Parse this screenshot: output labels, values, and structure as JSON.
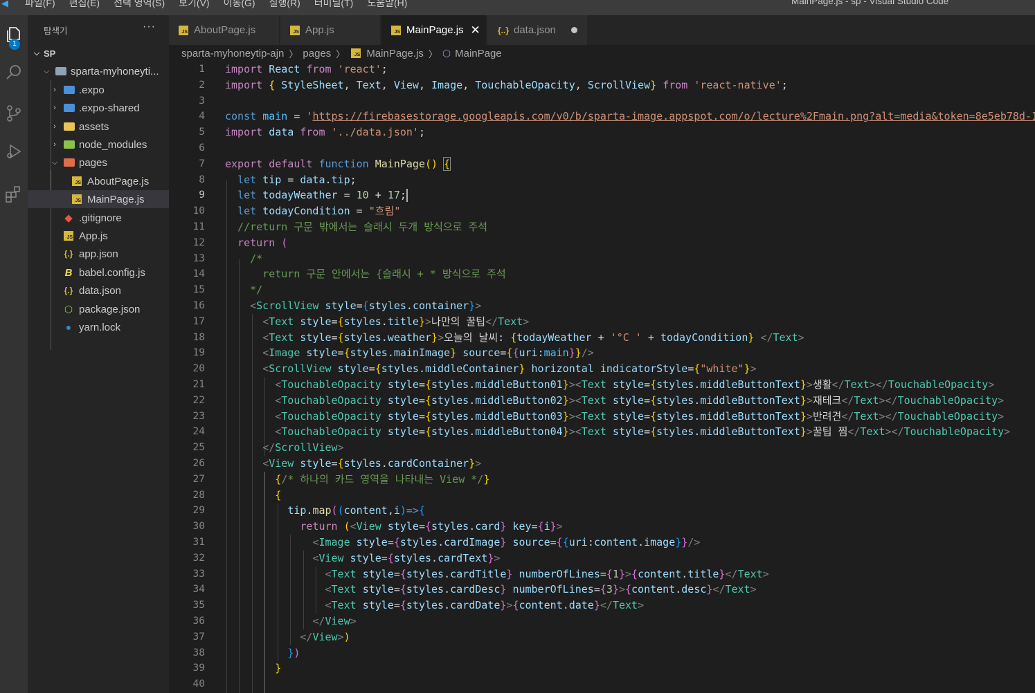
{
  "titlebar": {
    "menus": [
      "파일(F)",
      "편집(E)",
      "선택 영역(S)",
      "보기(V)",
      "이동(G)",
      "실행(R)",
      "터미널(T)",
      "도움말(H)"
    ],
    "title": "MainPage.js - sp - Visual Studio Code"
  },
  "activity": {
    "badge": "1",
    "icons": [
      "explorer-icon",
      "search-icon",
      "source-control-icon",
      "run-debug-icon",
      "extensions-icon"
    ]
  },
  "sidebar": {
    "header": "탐색기",
    "more": "···",
    "section": "SP",
    "tree": [
      {
        "label": "sparta-myhoneyti...",
        "type": "folder",
        "expanded": true
      },
      {
        "label": ".expo",
        "type": "folder-expo",
        "expanded": false
      },
      {
        "label": ".expo-shared",
        "type": "folder-expo",
        "expanded": false
      },
      {
        "label": "assets",
        "type": "folder",
        "expanded": false
      },
      {
        "label": "node_modules",
        "type": "folder-node",
        "expanded": false
      },
      {
        "label": "pages",
        "type": "folder-pages",
        "expanded": true
      },
      {
        "label": "AboutPage.js",
        "type": "js"
      },
      {
        "label": "MainPage.js",
        "type": "js",
        "selected": true
      },
      {
        "label": ".gitignore",
        "type": "git"
      },
      {
        "label": "App.js",
        "type": "js"
      },
      {
        "label": "app.json",
        "type": "json"
      },
      {
        "label": "babel.config.js",
        "type": "babel"
      },
      {
        "label": "data.json",
        "type": "json"
      },
      {
        "label": "package.json",
        "type": "npm"
      },
      {
        "label": "yarn.lock",
        "type": "yarn"
      }
    ]
  },
  "tabs": [
    {
      "label": "AboutPage.js",
      "icon": "JS"
    },
    {
      "label": "App.js",
      "icon": "JS"
    },
    {
      "label": "MainPage.js",
      "icon": "JS",
      "close": "✕"
    },
    {
      "label": "data.json",
      "icon": "{..}"
    }
  ],
  "breadcrumb": {
    "folder": "sparta-myhoneytip-ajn",
    "subfolder": "pages",
    "file": "MainPage.js",
    "symbol": "MainPage"
  },
  "editor": {
    "current_line": 9,
    "line_count": 40
  },
  "colors": {
    "accent": "#007acc",
    "keyword": "#569cd6",
    "string": "#ce9178",
    "comment": "#6a9955",
    "tag": "#4ec9b0"
  }
}
